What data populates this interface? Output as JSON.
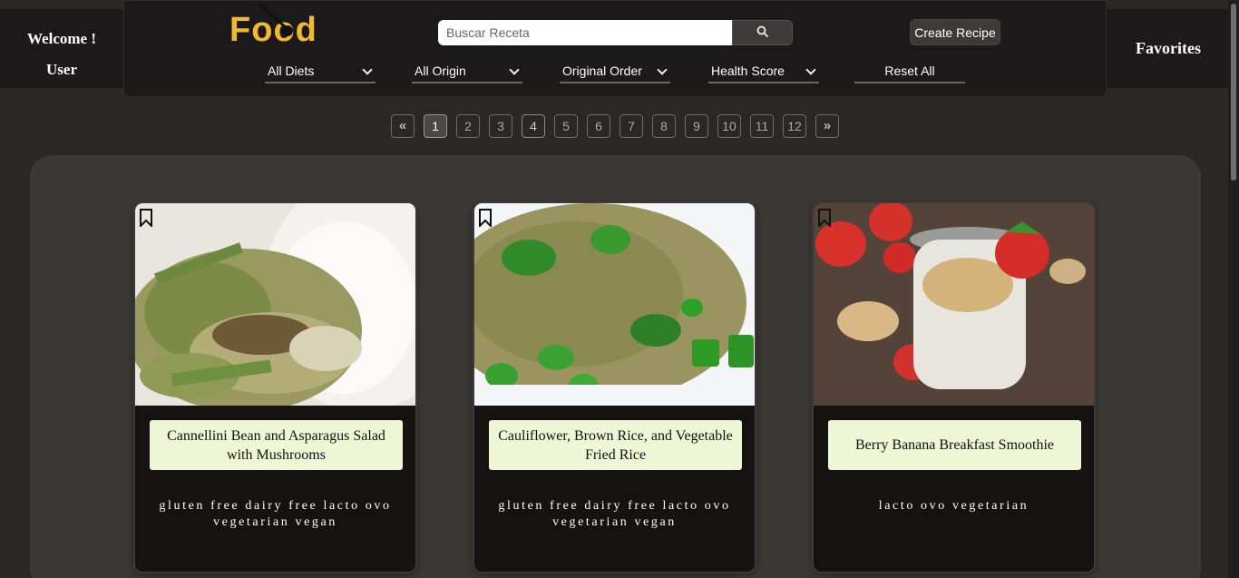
{
  "welcome": {
    "line1": "Welcome !",
    "line2": "User"
  },
  "favorites_label": "Favorites",
  "logo": {
    "pre": "Fo",
    "oo": "o",
    "post": "d"
  },
  "search": {
    "placeholder": "Buscar Receta",
    "icon": "search-icon"
  },
  "create_label": "Create Recipe",
  "filters": [
    {
      "label": "All Diets"
    },
    {
      "label": "All Origin"
    },
    {
      "label": "Original Order"
    },
    {
      "label": "Health Score"
    }
  ],
  "reset_label": "Reset All",
  "pagination": {
    "first": "«",
    "last": "»",
    "pages": [
      "1",
      "2",
      "3",
      "4",
      "5",
      "6",
      "7",
      "8",
      "9",
      "10",
      "11",
      "12"
    ],
    "current": "1"
  },
  "recipes": [
    {
      "title": "Cannellini Bean and Asparagus Salad with Mushrooms",
      "diets": "gluten free dairy free lacto ovo vegetarian vegan"
    },
    {
      "title": "Cauliflower, Brown Rice, and Vegetable Fried Rice",
      "diets": "gluten free dairy free lacto ovo vegetarian vegan"
    },
    {
      "title": "Berry Banana Breakfast Smoothie",
      "diets": "lacto ovo vegetarian"
    }
  ],
  "colors": {
    "accent": "#f2b733",
    "title_bg": "#eef6d5",
    "card_bg": "#161212",
    "panel_bg": "#3c3836"
  }
}
